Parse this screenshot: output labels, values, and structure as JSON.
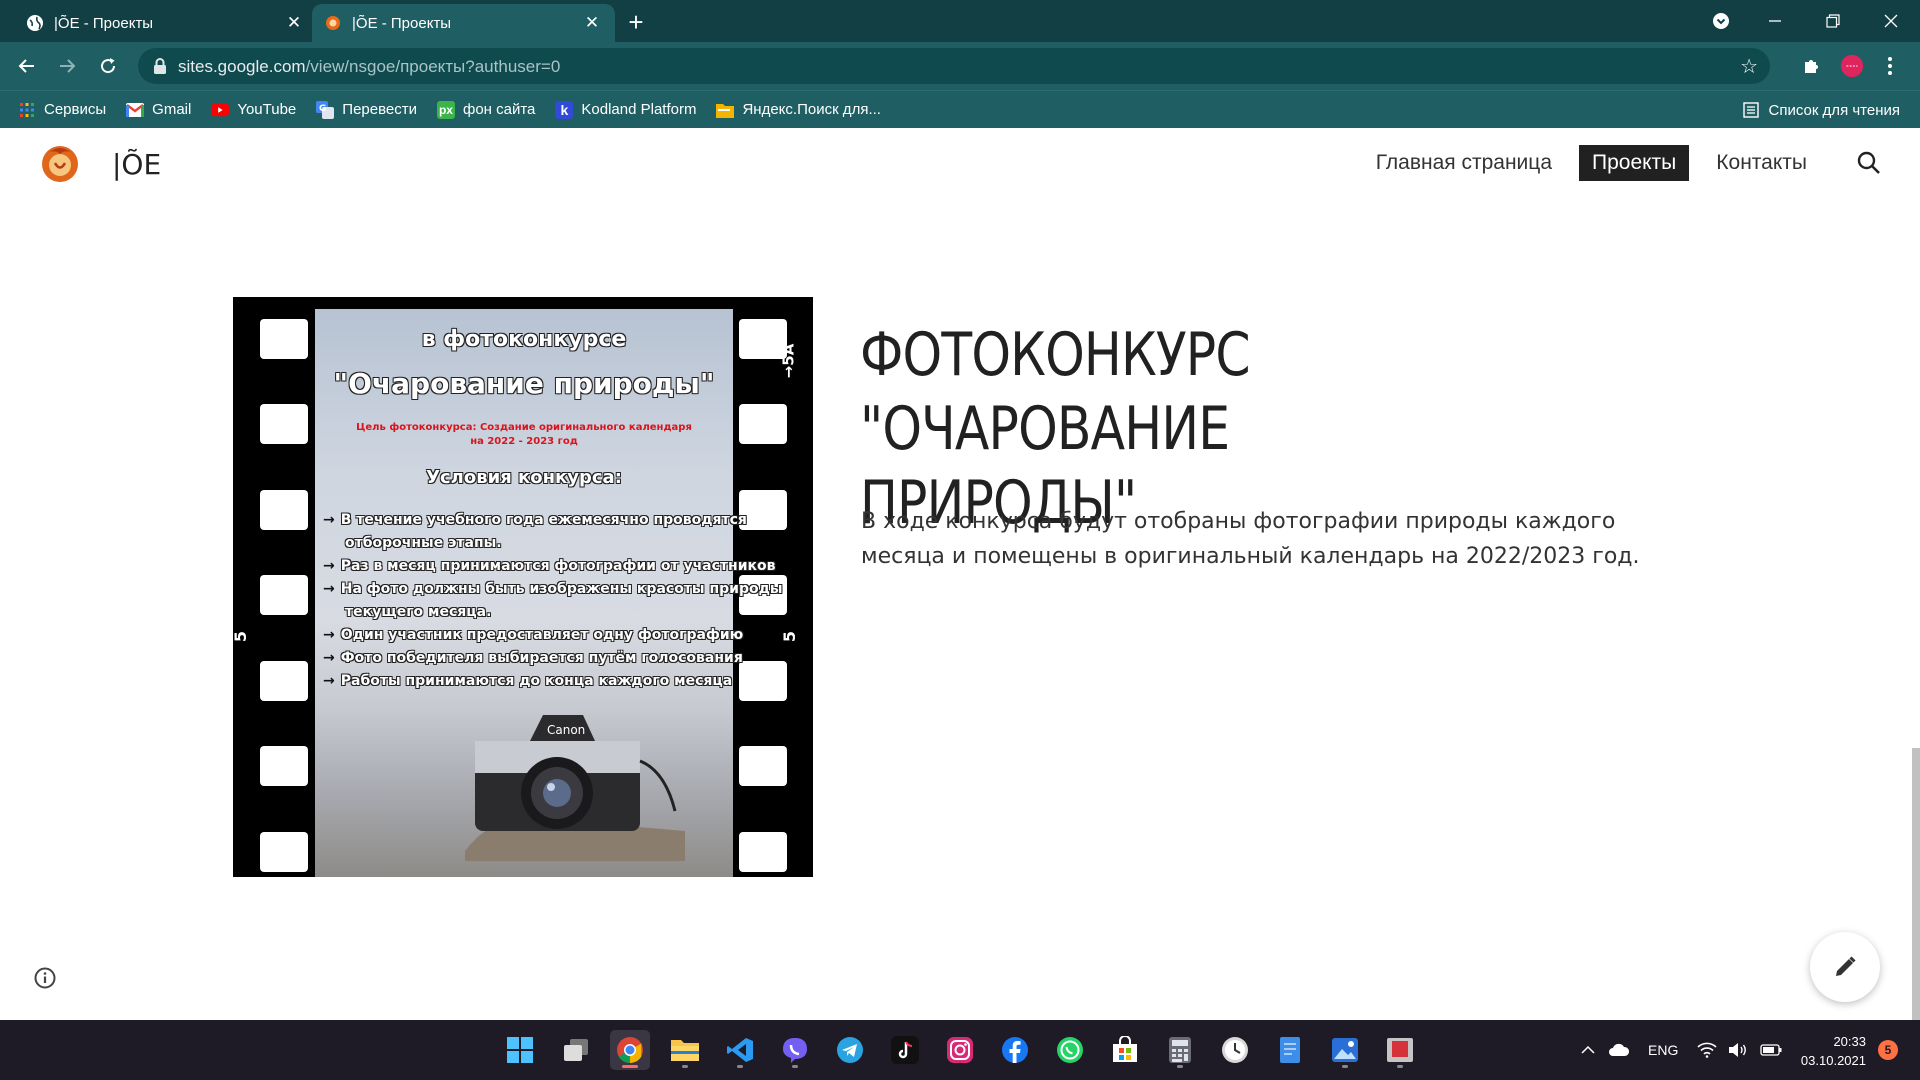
{
  "browser": {
    "tabs": [
      {
        "title": "|ÕE - Проекты",
        "close": "✕"
      },
      {
        "title": "|ÕE - Проекты",
        "close": "✕"
      }
    ],
    "new_tab": "+",
    "url_host": "sites.google.com",
    "url_path": "/view/nsgoe/проекты?authuser=0",
    "bookmarks": [
      {
        "label": "Сервисы",
        "icon": "apps-grid-icon"
      },
      {
        "label": "Gmail",
        "icon": "gmail-icon"
      },
      {
        "label": "YouTube",
        "icon": "youtube-icon"
      },
      {
        "label": "Перевести",
        "icon": "translate-icon"
      },
      {
        "label": "фон сайта",
        "icon": "px-icon"
      },
      {
        "label": "Kodland Platform",
        "icon": "kodland-icon"
      },
      {
        "label": "Яндекс.Поиск для...",
        "icon": "folder-icon"
      }
    ],
    "reading_list": "Список для чтения"
  },
  "site": {
    "name": "|ÕE",
    "nav": [
      {
        "label": "Главная страница",
        "active": false
      },
      {
        "label": "Проекты",
        "active": true
      },
      {
        "label": "Контакты",
        "active": false
      }
    ]
  },
  "main": {
    "heading": "ФОТОКОНКУРС \"ОЧАРОВАНИЕ ПРИРОДЫ\"",
    "body": "В ходе конкурса будут отобраны фотографии природы каждого месяца и помещены в оригинальный календарь на 2022/2023 год.",
    "poster": {
      "line1": "в фотоконкурсе",
      "line2": "\"Очарование природы\"",
      "goal": "Цель фотоконкурса: Создание оригинального календаря",
      "goal2": "на 2022 - 2023 год",
      "conditions_title": "Условия конкурса:",
      "conditions": [
        "В течение учебного года ежемесячно  проводятся",
        "отборочные этапы.",
        "Раз в месяц принимаются фотографии от участников",
        "На фото должны быть изображены красоты природы",
        "текущего месяца.",
        "Один участник предоставляет одну фотографию",
        "Фото победителя выбирается путём голосования",
        "Работы принимаются до конца каждого месяца"
      ],
      "camera_brand": "Canon",
      "film_mark_top": "→5A",
      "film_mark_left": "5",
      "film_mark_right": "5"
    }
  },
  "taskbar": {
    "apps": [
      "windows-start-icon",
      "task-view-icon",
      "chrome-icon",
      "file-explorer-icon",
      "vscode-icon",
      "viber-icon",
      "telegram-icon",
      "tiktok-icon",
      "instagram-icon",
      "facebook-icon",
      "whatsapp-icon",
      "microsoft-store-icon",
      "calculator-icon",
      "clock-app-icon",
      "notepad-icon",
      "photos-icon",
      "app-red-icon"
    ],
    "lang": "ENG",
    "time": "20:33",
    "date": "03.10.2021",
    "notifications": "5"
  },
  "colors": {
    "tabbar": "#123f44",
    "toolbar": "#1f5f63",
    "nav_active_bg": "#212121",
    "taskbar": "#1e1a26"
  }
}
